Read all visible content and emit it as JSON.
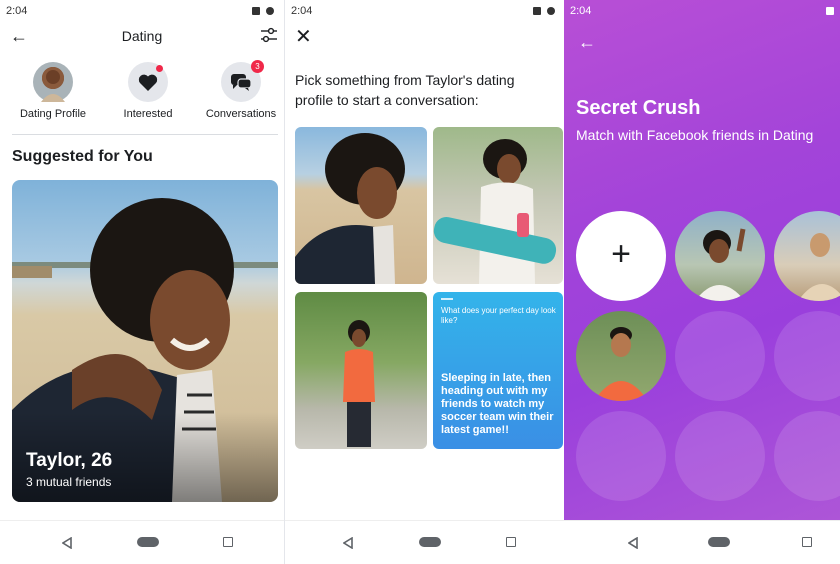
{
  "status_time": "2:04",
  "screen1": {
    "title": "Dating",
    "quick_actions": [
      {
        "label": "Dating Profile",
        "icon": "profile-avatar"
      },
      {
        "label": "Interested",
        "icon": "heart-icon"
      },
      {
        "label": "Conversations",
        "icon": "chat-icon",
        "badge": "3"
      }
    ],
    "section_title": "Suggested for You",
    "card": {
      "name": "Taylor, 26",
      "subtitle": "3 mutual friends"
    }
  },
  "screen2": {
    "prompt": "Pick something from Taylor's dating profile to start a conversation:",
    "question": "What does your perfect day look like?",
    "answer": "Sleeping in late, then heading out with my friends to watch my soccer team win their latest game!!"
  },
  "screen3": {
    "title": "Secret Crush",
    "subtitle": "Match with Facebook friends in Dating",
    "add_symbol": "+"
  },
  "colors": {
    "accent_purple": "#a344d9",
    "badge_red": "#f02849",
    "card_blue": "#3a8fe5"
  }
}
